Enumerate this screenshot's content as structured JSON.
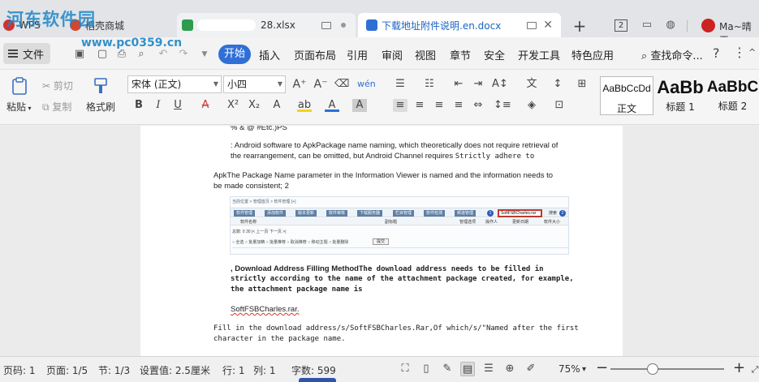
{
  "titlebar": {
    "tabs": [
      {
        "label": "WPS"
      },
      {
        "label": "稻壳商城"
      },
      {
        "label": "28.xlsx"
      },
      {
        "label": "下载地址附件说明.en.docx"
      }
    ],
    "tab_count": "2",
    "username": "Ma~晴天",
    "watermark": "河东软件园",
    "watermark_url": "www.pc0359.cn"
  },
  "menu": {
    "file": "文件",
    "items": [
      "开始",
      "插入",
      "页面布局",
      "引用",
      "审阅",
      "视图",
      "章节",
      "安全",
      "开发工具",
      "特色应用"
    ],
    "search_command": "查找命令..."
  },
  "ribbon": {
    "paste": "粘贴",
    "cut": "剪切",
    "copy": "复制",
    "format_painter": "格式刷",
    "font_name": "宋体 (正文)",
    "font_size": "小四",
    "styles": [
      {
        "sample": "AaBbCcDd",
        "label": "正文"
      },
      {
        "sample": "AaBb",
        "label": "标题 1"
      },
      {
        "sample": "AaBbC",
        "label": "标题 2"
      }
    ]
  },
  "document": {
    "line0": "% & @ #Etc.)PS",
    "line1": ": Android software to ApkPackage name naming, which theoretically does not require retrieval of",
    "line2a": "the rearrangement, can be omitted, but Android Channel requires ",
    "line2b": "Strictly adhere to",
    "line3": "ApkThe Package Name parameter in the Information Viewer is named and the information needs to",
    "line4": "be made consistent; 2",
    "line5a": ", Download Address Filling Method",
    "line5b": "The download address needs to be filled in",
    "line6": "strictly according to the name of the attachment package created, for example,",
    "line7": "the attachment package name is",
    "line8": "SoftFSBCharles.rar.",
    "line9a": "Fill in the download address/s/SoftFSBCharles.Rar,Of which/s/",
    "line9b": "\"Named after the first",
    "line10": "character in the package name."
  },
  "embedded": {
    "breadcrumb": "当前位置 > 管理首页 > 软件管理 [+]",
    "buttons": [
      "软件管理",
      "添加软件",
      "版本更新",
      "软件审核",
      "下载服务器",
      "栏目管理",
      "软件检测",
      "频道管理"
    ],
    "search_value": "SoftFSBCharles.rar",
    "badge1": "1",
    "badge2": "2",
    "go": "搜索",
    "columns": [
      "软件名称",
      "副标题",
      "管理选项",
      "操作人",
      "更新日期",
      "软件大小"
    ],
    "pager": "总数: 0  30  |<  上一页  下一页  >|",
    "actions": "○ 全选  ○ 批量加精  ○ 批量推荐  ○ 取消推荐  ○ 移动主题  ○ 批量删除",
    "submit": "提交"
  },
  "statusbar": {
    "page_no": "页码: 1",
    "pages": "页面: 1/5",
    "section": "节: 1/3",
    "setting": "设置值: 2.5厘米",
    "row": "行: 1",
    "col": "列: 1",
    "words": "字数: 599",
    "zoom": "75%"
  }
}
